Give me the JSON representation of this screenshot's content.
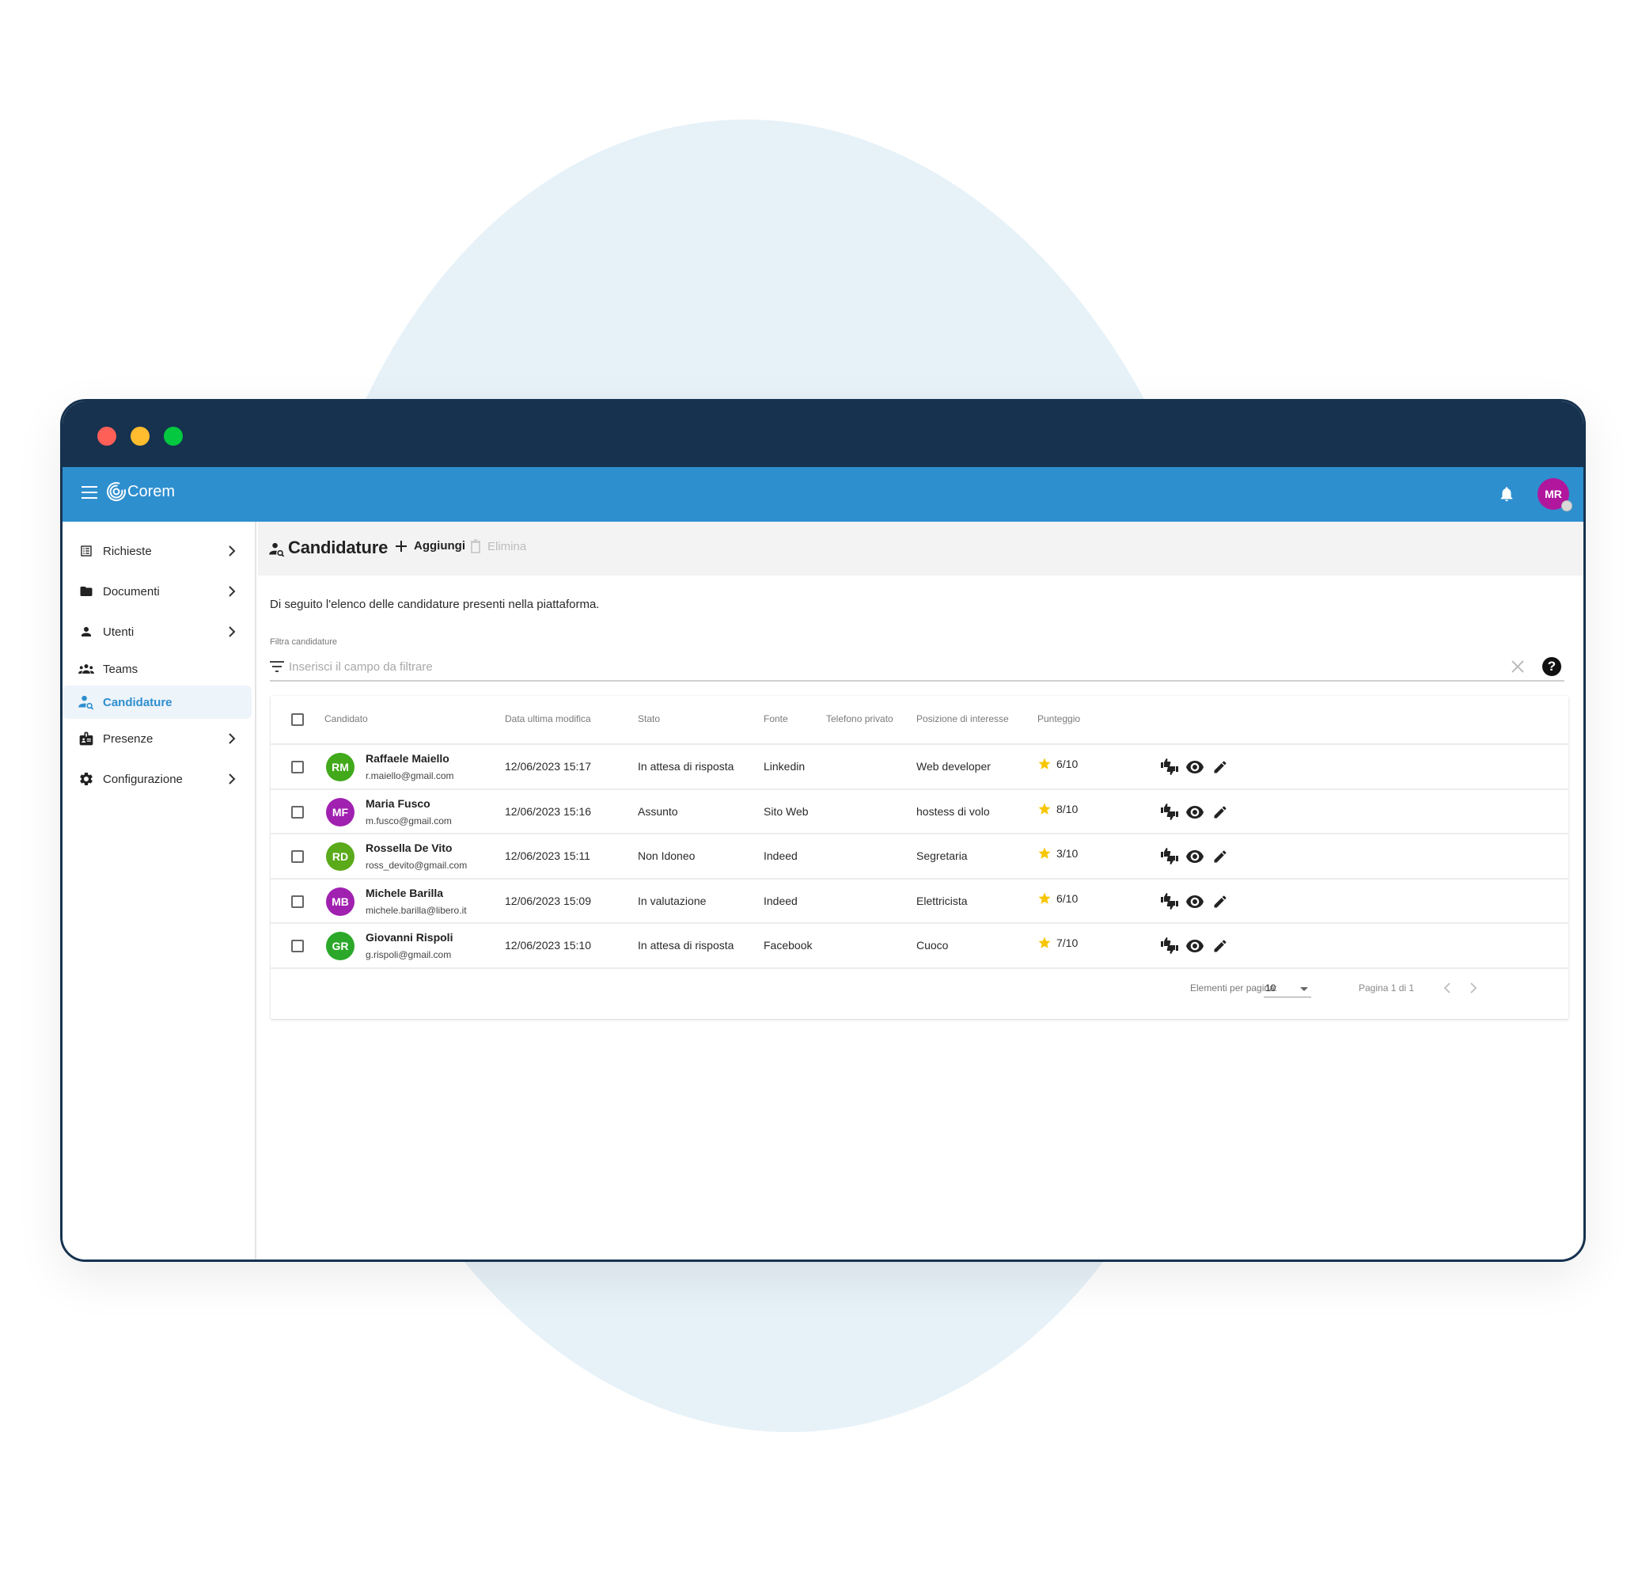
{
  "colors": {
    "titlebar": "#16324f",
    "appbar": "#2e8fcf",
    "accent": "#2e8fcf",
    "star": "#f7c600",
    "avatar_green": "#41a91a",
    "avatar_purple": "#a020b0",
    "user_avatar": "#b0179d"
  },
  "window": {
    "controls": [
      "close",
      "minimize",
      "maximize"
    ]
  },
  "appbar": {
    "menu_icon": "hamburger-icon",
    "brand": "Corem",
    "notification_icon": "bell-icon",
    "user_initials": "MR"
  },
  "sidebar": {
    "items": [
      {
        "label": "Richieste",
        "icon": "list-alt-icon",
        "has_children": true,
        "active": false
      },
      {
        "label": "Documenti",
        "icon": "folder-icon",
        "has_children": true,
        "active": false
      },
      {
        "label": "Utenti",
        "icon": "person-icon",
        "has_children": true,
        "active": false
      },
      {
        "label": "Teams",
        "icon": "groups-icon",
        "has_children": false,
        "active": false
      },
      {
        "label": "Candidature",
        "icon": "person-search-icon",
        "has_children": false,
        "active": true
      },
      {
        "label": "Presenze",
        "icon": "badge-icon",
        "has_children": true,
        "active": false
      },
      {
        "label": "Configurazione",
        "icon": "gear-icon",
        "has_children": true,
        "active": false
      }
    ]
  },
  "toolbar": {
    "title": "Candidature",
    "add_label": "Aggiungi",
    "delete_label": "Elimina"
  },
  "description": "Di seguito l'elenco delle candidature presenti nella piattaforma.",
  "filter": {
    "label": "Filtra candidature",
    "placeholder": "Inserisci il campo da filtrare",
    "value": "",
    "help_glyph": "?"
  },
  "table": {
    "columns": [
      "Candidato",
      "Data ultima modifica",
      "Stato",
      "Fonte",
      "Telefono privato",
      "Posizione di interesse",
      "Punteggio"
    ],
    "rows": [
      {
        "initials": "RM",
        "avatar_color": "#41a91a",
        "name": "Raffaele Maiello",
        "email": "r.maiello@gmail.com",
        "modified": "12/06/2023 15:17",
        "status": "In attesa di risposta",
        "source": "Linkedin",
        "phone": "",
        "position": "Web developer",
        "score": "6/10"
      },
      {
        "initials": "MF",
        "avatar_color": "#a020b0",
        "name": "Maria Fusco",
        "email": "m.fusco@gmail.com",
        "modified": "12/06/2023 15:16",
        "status": "Assunto",
        "source": "Sito Web",
        "phone": "",
        "position": "hostess di volo",
        "score": "8/10"
      },
      {
        "initials": "RD",
        "avatar_color": "#5aaa1a",
        "name": "Rossella De Vito",
        "email": "ross_devito@gmail.com",
        "modified": "12/06/2023 15:11",
        "status": "Non Idoneo",
        "source": "Indeed",
        "phone": "",
        "position": "Segretaria",
        "score": "3/10"
      },
      {
        "initials": "MB",
        "avatar_color": "#a020b0",
        "name": "Michele Barilla",
        "email": "michele.barilla@libero.it",
        "modified": "12/06/2023 15:09",
        "status": "In valutazione",
        "source": "Indeed",
        "phone": "",
        "position": "Elettricista",
        "score": "6/10"
      },
      {
        "initials": "GR",
        "avatar_color": "#2ba82a",
        "name": "Giovanni Rispoli",
        "email": "g.rispoli@gmail.com",
        "modified": "12/06/2023 15:10",
        "status": "In attesa di risposta",
        "source": "Facebook",
        "phone": "",
        "position": "Cuoco",
        "score": "7/10"
      }
    ],
    "row_actions": [
      "thumbs-up-down-icon",
      "eye-icon",
      "pencil-icon"
    ]
  },
  "pagination": {
    "per_page_label": "Elementi per pagina:",
    "per_page_value": "10",
    "page_label": "Pagina 1 di 1"
  }
}
